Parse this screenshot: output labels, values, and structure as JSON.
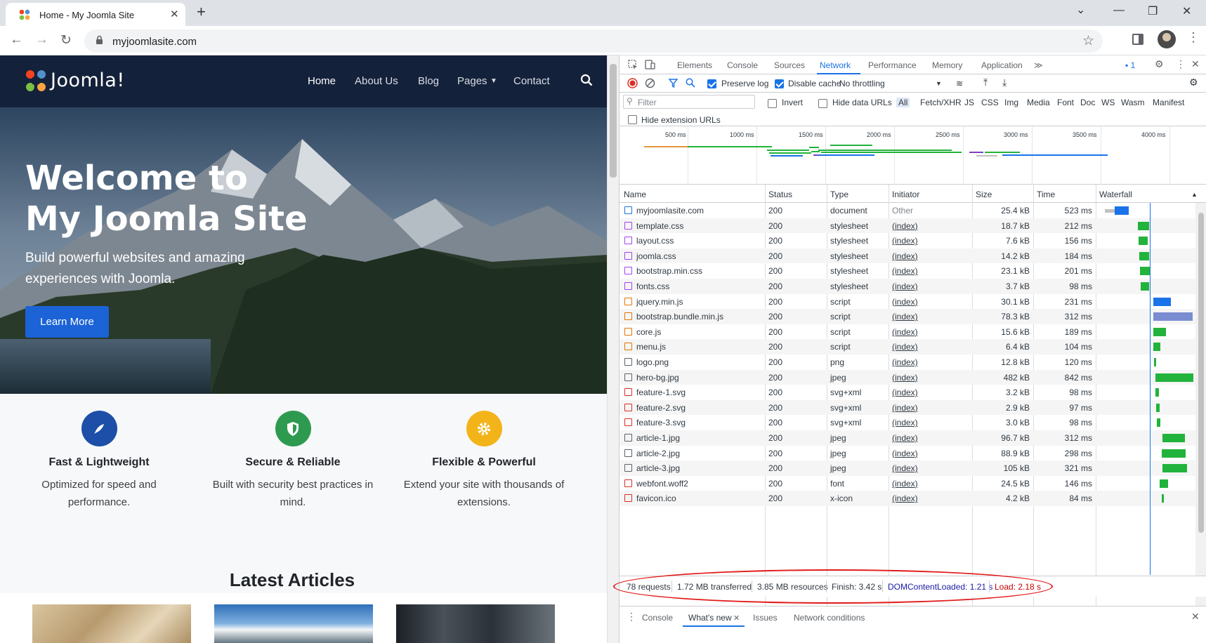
{
  "browser": {
    "tab_title": "Home - My Joomla Site",
    "tab_close": "✕",
    "new_tab": "+",
    "url": "myjoomlasite.com",
    "controls": {
      "down": "⌄",
      "min": "—",
      "max": "❐",
      "close": "✕"
    }
  },
  "site": {
    "logo_text": "Joomla!",
    "nav": [
      "Home",
      "About Us",
      "Blog",
      "Pages",
      "Contact"
    ],
    "hero_title": "Welcome to\nMy Joomla Site",
    "hero_subtitle": "Build powerful websites and amazing experiences with Joomla.",
    "hero_button": "Learn More",
    "features": [
      {
        "title": "Fast & Lightweight",
        "desc": "Optimized for speed and performance.",
        "color": "#1d4fa8",
        "icon": "rocket-icon"
      },
      {
        "title": "Secure & Reliable",
        "desc": "Built with security best practices in mind.",
        "color": "#2e9a4f",
        "icon": "shield-icon"
      },
      {
        "title": "Flexible & Powerful",
        "desc": "Extend your site with thousands of extensions.",
        "color": "#f3b41a",
        "icon": "gear-icon"
      }
    ],
    "articles_title": "Latest Articles"
  },
  "devtools": {
    "tabs": [
      "Elements",
      "Console",
      "Sources",
      "Network",
      "Performance",
      "Memory",
      "Application"
    ],
    "more_tabs": "≫",
    "issues_count": "1",
    "toolbar": {
      "preserve_log": "Preserve log",
      "disable_cache": "Disable cache",
      "throttling": "No throttling"
    },
    "filter": {
      "placeholder": "Filter",
      "invert": "Invert",
      "hide_data_urls": "Hide data URLs",
      "types": [
        "All",
        "Fetch/XHR",
        "JS",
        "CSS",
        "Img",
        "Media",
        "Font",
        "Doc",
        "WS",
        "Wasm",
        "Manifest"
      ],
      "hide_extension_urls": "Hide extension URLs"
    },
    "overview_ticks": [
      "500 ms",
      "1000 ms",
      "1500 ms",
      "2000 ms",
      "2500 ms",
      "3000 ms",
      "3500 ms",
      "4000 ms"
    ],
    "columns": [
      "Name",
      "Status",
      "Type",
      "Initiator",
      "Size",
      "Time",
      "Waterfall"
    ],
    "requests": [
      {
        "name": "myjoomlasite.com",
        "status": "200",
        "type": "document",
        "initiator": "Other",
        "size": "25.4 kB",
        "time": "523 ms",
        "kind": "doc"
      },
      {
        "name": "template.css",
        "status": "200",
        "type": "stylesheet",
        "initiator": "(index)",
        "size": "18.7 kB",
        "time": "212 ms",
        "kind": "css"
      },
      {
        "name": "layout.css",
        "status": "200",
        "type": "stylesheet",
        "initiator": "(index)",
        "size": "7.6 kB",
        "time": "156 ms",
        "kind": "css"
      },
      {
        "name": "joomla.css",
        "status": "200",
        "type": "stylesheet",
        "initiator": "(index)",
        "size": "14.2 kB",
        "time": "184 ms",
        "kind": "css"
      },
      {
        "name": "bootstrap.min.css",
        "status": "200",
        "type": "stylesheet",
        "initiator": "(index)",
        "size": "23.1 kB",
        "time": "201 ms",
        "kind": "css"
      },
      {
        "name": "fonts.css",
        "status": "200",
        "type": "stylesheet",
        "initiator": "(index)",
        "size": "3.7 kB",
        "time": "98 ms",
        "kind": "css"
      },
      {
        "name": "jquery.min.js",
        "status": "200",
        "type": "script",
        "initiator": "(index)",
        "size": "30.1 kB",
        "time": "231 ms",
        "kind": "js"
      },
      {
        "name": "bootstrap.bundle.min.js",
        "status": "200",
        "type": "script",
        "initiator": "(index)",
        "size": "78.3 kB",
        "time": "312 ms",
        "kind": "js"
      },
      {
        "name": "core.js",
        "status": "200",
        "type": "script",
        "initiator": "(index)",
        "size": "15.6 kB",
        "time": "189 ms",
        "kind": "js"
      },
      {
        "name": "menu.js",
        "status": "200",
        "type": "script",
        "initiator": "(index)",
        "size": "6.4 kB",
        "time": "104 ms",
        "kind": "js"
      },
      {
        "name": "logo.png",
        "status": "200",
        "type": "png",
        "initiator": "(index)",
        "size": "12.8 kB",
        "time": "120 ms",
        "kind": "img"
      },
      {
        "name": "hero-bg.jpg",
        "status": "200",
        "type": "jpeg",
        "initiator": "(index)",
        "size": "482 kB",
        "time": "842 ms",
        "kind": "jpg"
      },
      {
        "name": "feature-1.svg",
        "status": "200",
        "type": "svg+xml",
        "initiator": "(index)",
        "size": "3.2 kB",
        "time": "98 ms",
        "kind": "svg"
      },
      {
        "name": "feature-2.svg",
        "status": "200",
        "type": "svg+xml",
        "initiator": "(index)",
        "size": "2.9 kB",
        "time": "97 ms",
        "kind": "svg"
      },
      {
        "name": "feature-3.svg",
        "status": "200",
        "type": "svg+xml",
        "initiator": "(index)",
        "size": "3.0 kB",
        "time": "98 ms",
        "kind": "svg"
      },
      {
        "name": "article-1.jpg",
        "status": "200",
        "type": "jpeg",
        "initiator": "(index)",
        "size": "96.7 kB",
        "time": "312 ms",
        "kind": "jpg"
      },
      {
        "name": "article-2.jpg",
        "status": "200",
        "type": "jpeg",
        "initiator": "(index)",
        "size": "88.9 kB",
        "time": "298 ms",
        "kind": "jpg"
      },
      {
        "name": "article-3.jpg",
        "status": "200",
        "type": "jpeg",
        "initiator": "(index)",
        "size": "105 kB",
        "time": "321 ms",
        "kind": "jpg"
      },
      {
        "name": "webfont.woff2",
        "status": "200",
        "type": "font",
        "initiator": "(index)",
        "size": "24.5 kB",
        "time": "146 ms",
        "kind": "font"
      },
      {
        "name": "favicon.ico",
        "status": "200",
        "type": "x-icon",
        "initiator": "(index)",
        "size": "4.2 kB",
        "time": "84 ms",
        "kind": "ico"
      }
    ],
    "summary": {
      "requests": "78 requests",
      "transferred": "1.72 MB transferred",
      "resources": "3.85 MB resources",
      "finish": "Finish: 3.42 s",
      "dcl": "DOMContentLoaded: 1.21 s",
      "load": "Load: 2.18 s"
    },
    "drawer_tabs": [
      "Console",
      "What's new",
      "Issues",
      "Network conditions"
    ],
    "colors": {
      "accent": "#1a73e8",
      "dcl": "#1a1aa6",
      "load": "#c80000",
      "highlight": "#e21a1a"
    }
  }
}
